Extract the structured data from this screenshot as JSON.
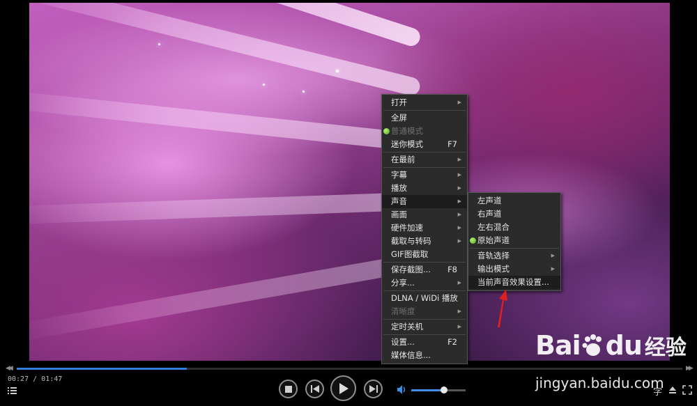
{
  "main_menu": {
    "items": [
      {
        "label": "打开",
        "submenu": true
      },
      {
        "separator": true
      },
      {
        "label": "全屏"
      },
      {
        "label": "普通模式",
        "disabled": true,
        "checked": true
      },
      {
        "label": "迷你模式",
        "shortcut": "F7"
      },
      {
        "separator": true
      },
      {
        "label": "在最前",
        "submenu": true
      },
      {
        "separator": true
      },
      {
        "label": "字幕",
        "submenu": true
      },
      {
        "label": "播放",
        "submenu": true
      },
      {
        "label": "声音",
        "submenu": true,
        "highlighted": true
      },
      {
        "label": "画面",
        "submenu": true
      },
      {
        "label": "硬件加速",
        "submenu": true
      },
      {
        "label": "截取与转码",
        "submenu": true
      },
      {
        "label": "GIF图截取"
      },
      {
        "separator": true
      },
      {
        "label": "保存截图...",
        "shortcut": "F8"
      },
      {
        "label": "分享...",
        "submenu": true
      },
      {
        "separator": true
      },
      {
        "label": "DLNA / WiDi 播放"
      },
      {
        "label": "清晰度",
        "disabled": true,
        "submenu": true
      },
      {
        "separator": true
      },
      {
        "label": "定时关机",
        "submenu": true
      },
      {
        "separator": true
      },
      {
        "label": "设置...",
        "shortcut": "F2"
      },
      {
        "label": "媒体信息..."
      }
    ]
  },
  "sound_submenu": {
    "items": [
      {
        "label": "左声道"
      },
      {
        "label": "右声道"
      },
      {
        "label": "左右混合"
      },
      {
        "label": "原始声道",
        "checked": true
      },
      {
        "separator": true
      },
      {
        "label": "音轨选择",
        "submenu": true
      },
      {
        "label": "输出模式",
        "submenu": true
      },
      {
        "label": "当前声音效果设置...",
        "highlighted": true
      }
    ]
  },
  "player": {
    "current_time": "00:27",
    "total_time": "01:47",
    "time_separator": " / ",
    "progress": 0.255,
    "volume": 0.6,
    "subtitle_label": "字",
    "accent_color": "#2f7fd8"
  },
  "watermark": {
    "logo_text": "Bai",
    "logo_text2": "du",
    "logo_cn": "经验",
    "url": "jingyan.baidu.com"
  },
  "icons": {
    "stop": "stop-icon",
    "prev": "previous-icon",
    "play": "play-icon",
    "next": "next-icon",
    "volume": "volume-icon",
    "playlist": "playlist-icon",
    "eject": "eject-icon",
    "fullscreen": "fullscreen-icon"
  }
}
